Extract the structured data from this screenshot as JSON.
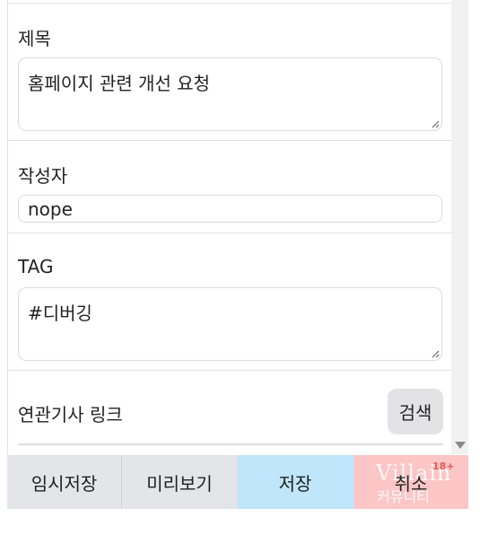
{
  "form": {
    "title_label": "제목",
    "title_value": "홈페이지 관련 개선 요청",
    "author_label": "작성자",
    "author_value": "nope",
    "tag_label": "TAG",
    "tag_value": "#디버깅",
    "related_label": "연관기사 링크",
    "search_label": "검색"
  },
  "toolbar": {
    "temp_save_label": "임시저장",
    "preview_label": "미리보기",
    "save_label": "저장",
    "cancel_label": "취소"
  },
  "watermark": {
    "brand": "Villain",
    "sub": "커뮤니티",
    "badge": "18+"
  },
  "colors": {
    "save_bg": "#bfe6fb",
    "cancel_bg": "#fcc6c6",
    "neutral_bg": "#e4e5e9"
  }
}
